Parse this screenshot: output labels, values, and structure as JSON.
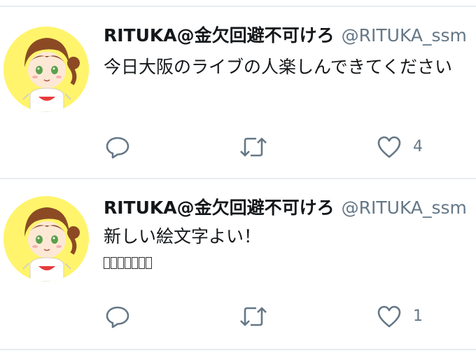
{
  "tweets": [
    {
      "name": "RITUKA@金欠回避不可けろ",
      "handle": "@RITUKA_ssm",
      "text": "今日大阪のライブの人楽しんできてください",
      "extra_boxes": 0,
      "actions": {
        "reply_icon": "reply-icon",
        "retweet_icon": "retweet-icon",
        "like_icon": "heart-icon",
        "like_count": "4"
      }
    },
    {
      "name": "RITUKA@金欠回避不可けろ",
      "handle": "@RITUKA_ssm",
      "text": "新しい絵文字よい！",
      "extra_boxes": 7,
      "actions": {
        "reply_icon": "reply-icon",
        "retweet_icon": "retweet-icon",
        "like_icon": "heart-icon",
        "like_count": "1"
      }
    }
  ],
  "colors": {
    "avatar_bg": "#fff46b",
    "name": "#14171a",
    "secondary": "#657786",
    "divider": "#e6ecf0"
  }
}
